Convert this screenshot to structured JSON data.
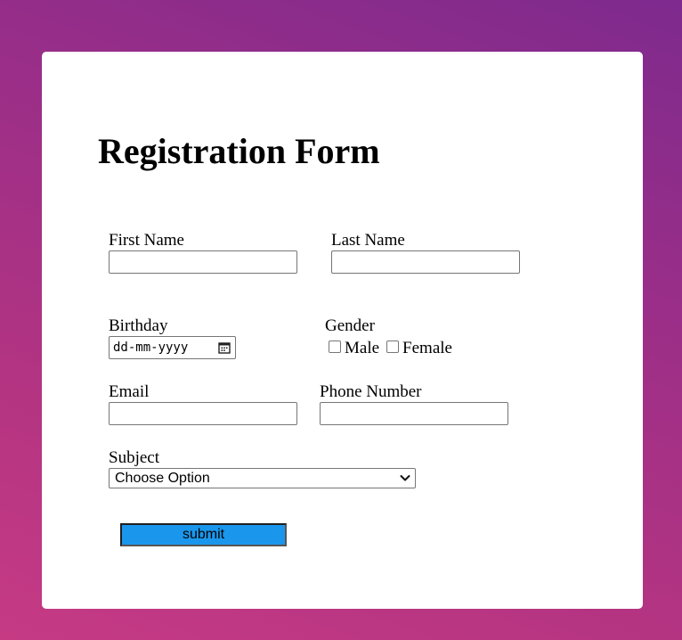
{
  "form": {
    "title": "Registration Form",
    "first_name": {
      "label": "First Name",
      "value": ""
    },
    "last_name": {
      "label": "Last Name",
      "value": ""
    },
    "birthday": {
      "label": "Birthday",
      "placeholder": "dd-mm-yyyy"
    },
    "gender": {
      "label": "Gender",
      "options": [
        {
          "label": "Male",
          "checked": false
        },
        {
          "label": "Female",
          "checked": false
        }
      ]
    },
    "email": {
      "label": "Email",
      "value": ""
    },
    "phone": {
      "label": "Phone Number",
      "value": ""
    },
    "subject": {
      "label": "Subject",
      "selected": "Choose Option"
    },
    "submit_label": "submit"
  },
  "colors": {
    "background_gradient": [
      "#7e2a8e",
      "#c63a84"
    ],
    "card": "#ffffff",
    "submit_button": "#1a97ec"
  },
  "icons": {
    "birthday": "calendar-icon",
    "subject": "chevron-down-icon"
  }
}
